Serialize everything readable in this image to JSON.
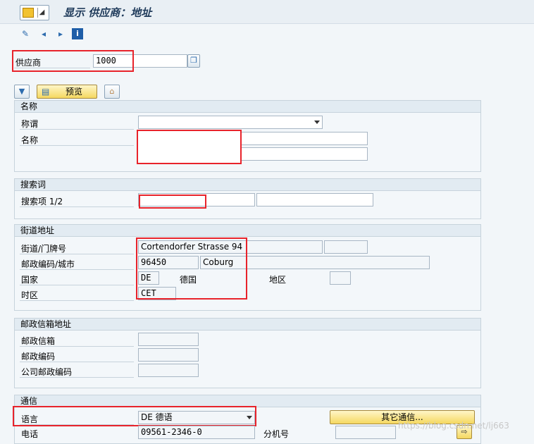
{
  "header": {
    "title": "显示 供应商：地址"
  },
  "vendor": {
    "label": "供应商",
    "value": "1000"
  },
  "buttons": {
    "preview": "预览",
    "more_comm": "其它通信..."
  },
  "name_group": {
    "title": "名称",
    "salutation_label": "称谓",
    "name_label": "名称"
  },
  "search_group": {
    "title": "搜索词",
    "search_label": "搜索项 1/2"
  },
  "street_group": {
    "title": "街道地址",
    "street_label": "街道/门牌号",
    "street_value": "Cortendorfer Strasse 94",
    "postal_label": "邮政编码/城市",
    "postal_value": "96450",
    "city_value": "Coburg",
    "country_label": "国家",
    "country_code": "DE",
    "country_name": "德国",
    "region_label": "地区",
    "timezone_label": "时区",
    "timezone_value": "CET"
  },
  "pobox_group": {
    "title": "邮政信箱地址",
    "pobox_label": "邮政信箱",
    "postal_label": "邮政编码",
    "company_postal_label": "公司邮政编码"
  },
  "comm_group": {
    "title": "通信",
    "language_label": "语言",
    "language_value": "DE 德语",
    "phone_label": "电话",
    "phone_value": "09561-2346-0",
    "ext_label": "分机号"
  },
  "watermark": "https://blog.csdn.net/lj663",
  "colors": {
    "highlight": "#e8232b",
    "button": "#f5d860"
  }
}
